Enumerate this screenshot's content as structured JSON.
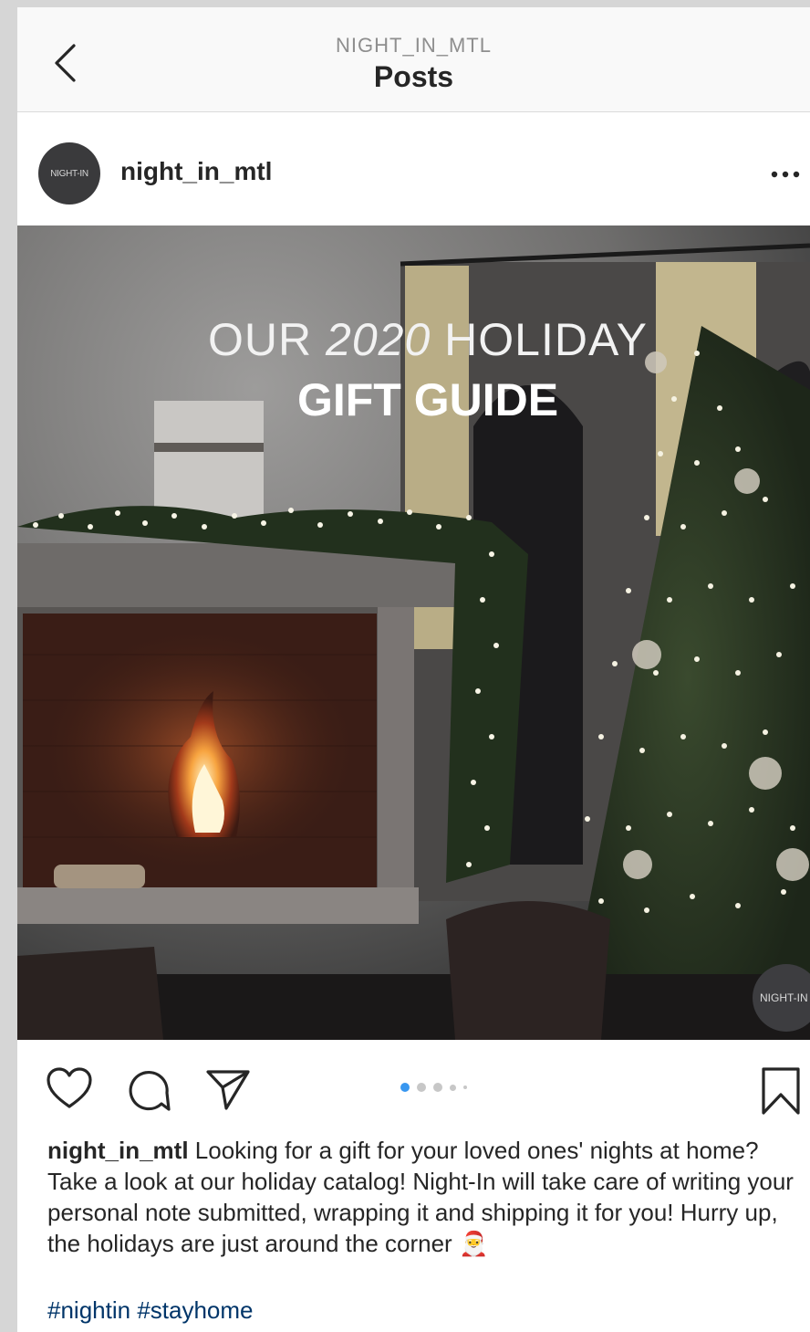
{
  "header": {
    "handle": "NIGHT_IN_MTL",
    "title": "Posts"
  },
  "post": {
    "username": "night_in_mtl",
    "avatar_text": "NIGHT-IN",
    "image": {
      "overlay_line1_a": "OUR",
      "overlay_line1_year": "2020",
      "overlay_line1_b": "HOLIDAY",
      "overlay_line2": "GIFT GUIDE",
      "watermark": "NIGHT-IN"
    },
    "carousel": {
      "count": 5,
      "active_index": 0
    },
    "caption": {
      "username": "night_in_mtl",
      "text": "Looking for a gift for your loved ones' nights at home? Take a look at our holiday catalog! Night-In will take care of writing your personal note submitted, wrapping it and shipping it for you! Hurry up, the holidays are just around the corner",
      "emoji": "🎅"
    },
    "hashtags": [
      "#nightin",
      "#stayhome"
    ]
  },
  "icons": {
    "back": "chevron-left-icon",
    "more": "more-dots-icon",
    "like": "heart-icon",
    "comment": "comment-icon",
    "share": "send-icon",
    "save": "bookmark-icon"
  },
  "colors": {
    "link": "#003569",
    "active_dot": "#3897f0",
    "text": "#262626",
    "muted": "#8e8e8e"
  }
}
